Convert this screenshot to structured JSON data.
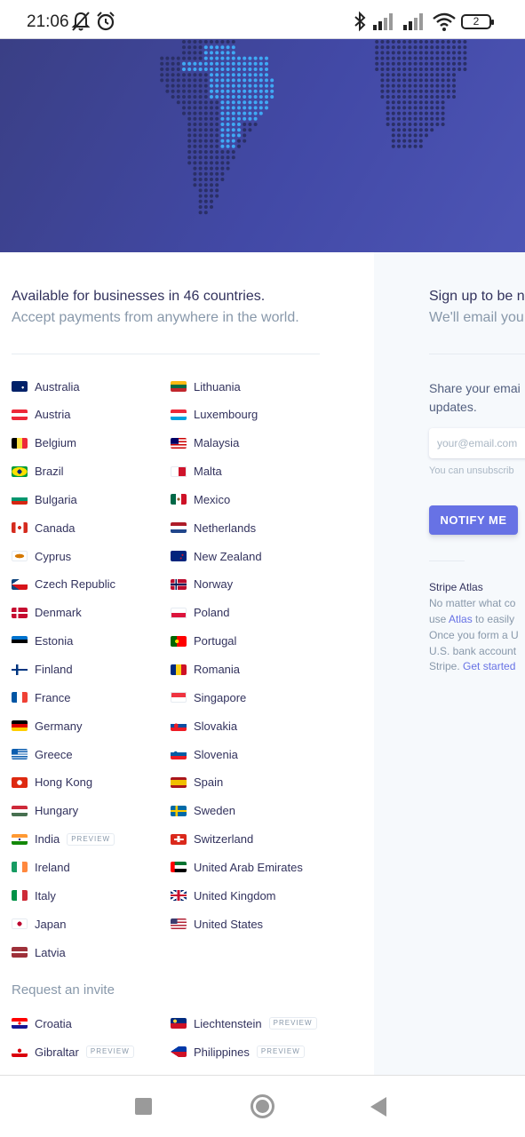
{
  "status_bar": {
    "time": "21:06",
    "battery": "2",
    "icons": [
      "bell-off-icon",
      "alarm-icon",
      "bluetooth-icon",
      "signal-icon",
      "signal-icon",
      "wifi-icon",
      "battery-icon"
    ]
  },
  "hero": {
    "background": "#4249a6",
    "dot_color": "#2a2f66",
    "highlight_color": "#3fa9f5"
  },
  "availability": {
    "title": "Available for businesses in 46 countries.",
    "subtitle": "Accept payments from anywhere in the world."
  },
  "countries": {
    "left": [
      {
        "name": "Australia",
        "flag": "australia-flag-icon"
      },
      {
        "name": "Austria",
        "flag": "austria-flag-icon"
      },
      {
        "name": "Belgium",
        "flag": "belgium-flag-icon"
      },
      {
        "name": "Brazil",
        "flag": "brazil-flag-icon"
      },
      {
        "name": "Bulgaria",
        "flag": "bulgaria-flag-icon"
      },
      {
        "name": "Canada",
        "flag": "canada-flag-icon"
      },
      {
        "name": "Cyprus",
        "flag": "cyprus-flag-icon"
      },
      {
        "name": "Czech Republic",
        "flag": "czech-flag-icon"
      },
      {
        "name": "Denmark",
        "flag": "denmark-flag-icon"
      },
      {
        "name": "Estonia",
        "flag": "estonia-flag-icon"
      },
      {
        "name": "Finland",
        "flag": "finland-flag-icon"
      },
      {
        "name": "France",
        "flag": "france-flag-icon"
      },
      {
        "name": "Germany",
        "flag": "germany-flag-icon"
      },
      {
        "name": "Greece",
        "flag": "greece-flag-icon"
      },
      {
        "name": "Hong Kong",
        "flag": "hong-kong-flag-icon"
      },
      {
        "name": "Hungary",
        "flag": "hungary-flag-icon"
      },
      {
        "name": "India",
        "flag": "india-flag-icon",
        "badge": "PREVIEW"
      },
      {
        "name": "Ireland",
        "flag": "ireland-flag-icon"
      },
      {
        "name": "Italy",
        "flag": "italy-flag-icon"
      },
      {
        "name": "Japan",
        "flag": "japan-flag-icon"
      },
      {
        "name": "Latvia",
        "flag": "latvia-flag-icon"
      }
    ],
    "right": [
      {
        "name": "Lithuania",
        "flag": "lithuania-flag-icon"
      },
      {
        "name": "Luxembourg",
        "flag": "luxembourg-flag-icon"
      },
      {
        "name": "Malaysia",
        "flag": "malaysia-flag-icon"
      },
      {
        "name": "Malta",
        "flag": "malta-flag-icon"
      },
      {
        "name": "Mexico",
        "flag": "mexico-flag-icon"
      },
      {
        "name": "Netherlands",
        "flag": "netherlands-flag-icon"
      },
      {
        "name": "New Zealand",
        "flag": "new-zealand-flag-icon"
      },
      {
        "name": "Norway",
        "flag": "norway-flag-icon"
      },
      {
        "name": "Poland",
        "flag": "poland-flag-icon"
      },
      {
        "name": "Portugal",
        "flag": "portugal-flag-icon"
      },
      {
        "name": "Romania",
        "flag": "romania-flag-icon"
      },
      {
        "name": "Singapore",
        "flag": "singapore-flag-icon"
      },
      {
        "name": "Slovakia",
        "flag": "slovakia-flag-icon"
      },
      {
        "name": "Slovenia",
        "flag": "slovenia-flag-icon"
      },
      {
        "name": "Spain",
        "flag": "spain-flag-icon"
      },
      {
        "name": "Sweden",
        "flag": "sweden-flag-icon"
      },
      {
        "name": "Switzerland",
        "flag": "switzerland-flag-icon"
      },
      {
        "name": "United Arab Emirates",
        "flag": "uae-flag-icon"
      },
      {
        "name": "United Kingdom",
        "flag": "uk-flag-icon"
      },
      {
        "name": "United States",
        "flag": "us-flag-icon"
      }
    ]
  },
  "invite": {
    "title": "Request an invite",
    "left": [
      {
        "name": "Croatia",
        "flag": "croatia-flag-icon"
      },
      {
        "name": "Gibraltar",
        "flag": "gibraltar-flag-icon",
        "badge": "PREVIEW"
      }
    ],
    "right": [
      {
        "name": "Liechtenstein",
        "flag": "liechtenstein-flag-icon",
        "badge": "PREVIEW"
      },
      {
        "name": "Philippines",
        "flag": "philippines-flag-icon",
        "badge": "PREVIEW"
      }
    ]
  },
  "signup": {
    "title": "Sign up to be n",
    "subtitle": "We'll email you",
    "share_line1": "Share your emai",
    "share_line2": "updates.",
    "email_placeholder": "your@email.com",
    "unsubscribe": "You can unsubscrib",
    "notify_label": "NOTIFY ME",
    "button_color": "#6772e5"
  },
  "atlas": {
    "title": "Stripe Atlas",
    "line1": "No matter what co",
    "line2_pre": "use ",
    "line2_link": "Atlas",
    "line2_post": " to easily",
    "line3": "Once you form a U",
    "line4": "U.S. bank account",
    "line5_pre": "Stripe. ",
    "line5_link": "Get started"
  },
  "nav": {
    "icons": [
      "recents-square-icon",
      "home-circle-icon",
      "back-triangle-icon"
    ]
  }
}
